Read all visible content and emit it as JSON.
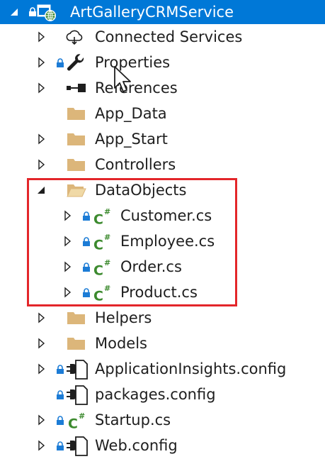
{
  "project": {
    "name": "ArtGalleryCRMService"
  },
  "items": [
    {
      "label": "Connected Services",
      "icon": "connected-services-icon",
      "expander": "collapsed",
      "locked": false
    },
    {
      "label": "Properties",
      "icon": "wrench-icon",
      "expander": "collapsed",
      "locked": true
    },
    {
      "label": "References",
      "icon": "references-icon",
      "expander": "collapsed",
      "locked": false
    },
    {
      "label": "App_Data",
      "icon": "folder-icon",
      "expander": "none",
      "locked": false
    },
    {
      "label": "App_Start",
      "icon": "folder-icon",
      "expander": "collapsed",
      "locked": false
    },
    {
      "label": "Controllers",
      "icon": "folder-icon",
      "expander": "collapsed",
      "locked": false
    },
    {
      "label": "DataObjects",
      "icon": "folder-open-icon",
      "expander": "expanded",
      "locked": false
    },
    {
      "label": "Customer.cs",
      "icon": "csharp-file-icon",
      "expander": "collapsed",
      "locked": true
    },
    {
      "label": "Employee.cs",
      "icon": "csharp-file-icon",
      "expander": "collapsed",
      "locked": true
    },
    {
      "label": "Order.cs",
      "icon": "csharp-file-icon",
      "expander": "collapsed",
      "locked": true
    },
    {
      "label": "Product.cs",
      "icon": "csharp-file-icon",
      "expander": "collapsed",
      "locked": true
    },
    {
      "label": "Helpers",
      "icon": "folder-icon",
      "expander": "collapsed",
      "locked": false
    },
    {
      "label": "Models",
      "icon": "folder-icon",
      "expander": "collapsed",
      "locked": false
    },
    {
      "label": "ApplicationInsights.config",
      "icon": "config-file-icon",
      "expander": "collapsed",
      "locked": true
    },
    {
      "label": "packages.config",
      "icon": "config-file-icon",
      "expander": "none",
      "locked": true
    },
    {
      "label": "Startup.cs",
      "icon": "csharp-file-icon",
      "expander": "collapsed",
      "locked": true
    },
    {
      "label": "Web.config",
      "icon": "config-file-icon",
      "expander": "collapsed",
      "locked": true
    }
  ],
  "icons": {
    "csharp_text": "C",
    "csharp_sup": "#"
  },
  "colors": {
    "selection": "#0078d7",
    "folder": "#dcb67a",
    "csharp": "#3c8a2e",
    "lock": "#1c7cd6",
    "highlight": "#e3262a",
    "text": "#1e1e1e"
  }
}
